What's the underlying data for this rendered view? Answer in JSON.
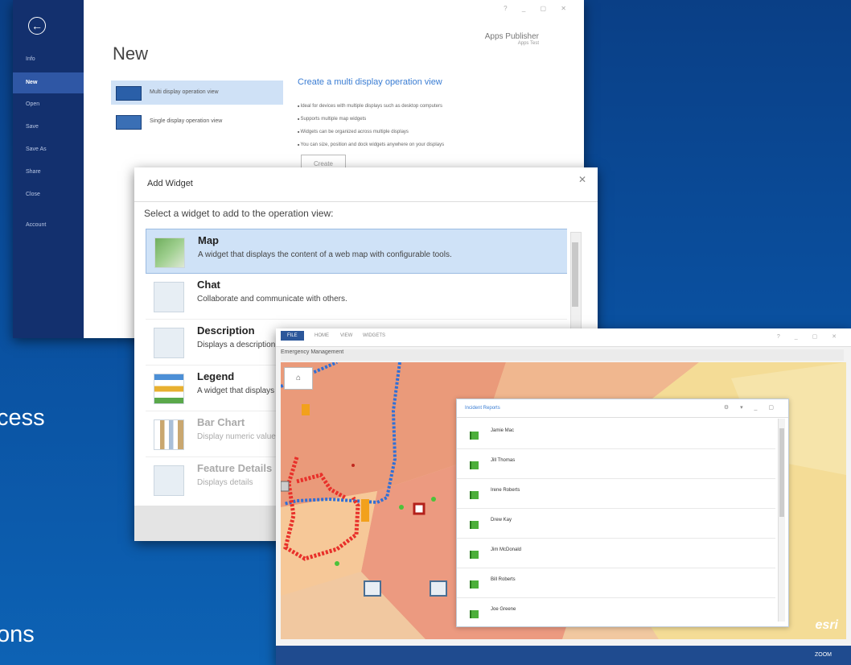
{
  "slide": {
    "text1": "cess",
    "text2": "ons"
  },
  "new_window": {
    "title": "New",
    "publisher": "Apps Publisher",
    "publisher_sub": "Apps Test",
    "rail_items": [
      "Info",
      "New",
      "Open",
      "Save",
      "Save As",
      "Share",
      "Close",
      "Account"
    ],
    "options": [
      {
        "label": "Multi display operation view"
      },
      {
        "label": "Single display operation view"
      }
    ],
    "content_heading": "Create a multi display operation view",
    "bullets": [
      "Ideal for devices with multiple displays such as desktop computers",
      "Supports multiple map widgets",
      "Widgets can be organized across multiple displays",
      "You can size, position and dock widgets anywhere on your displays"
    ],
    "create_button": "Create"
  },
  "add_widget": {
    "title": "Add Widget",
    "prompt": "Select a widget to add to the operation view:",
    "items": [
      {
        "name": "Map",
        "desc": "A widget that displays the content of a web map with configurable tools."
      },
      {
        "name": "Chat",
        "desc": "Collaborate and communicate with others."
      },
      {
        "name": "Description",
        "desc": "Displays a description"
      },
      {
        "name": "Legend",
        "desc": "A widget that displays the legend"
      },
      {
        "name": "Bar Chart",
        "desc": "Display numeric values"
      },
      {
        "name": "Feature Details",
        "desc": "Displays details"
      }
    ]
  },
  "ops_window": {
    "tabs": [
      "FILE",
      "HOME",
      "VIEW",
      "WIDGETS"
    ],
    "view_title": "Emergency Management",
    "status_text": "ZOOM",
    "esri": "esri"
  },
  "incident_panel": {
    "title": "Incident Reports",
    "people": [
      "Jamie Mac",
      "Jill Thomas",
      "Irene Roberts",
      "Drew Kay",
      "Jim McDonald",
      "Bill Roberts",
      "Joe Greene"
    ]
  },
  "colors": {
    "accent_blue": "#2b579a",
    "rail": "#13306e",
    "incident_green": "#4caf3a",
    "route_red": "#e8302a",
    "route_blue": "#2f6fd6"
  }
}
